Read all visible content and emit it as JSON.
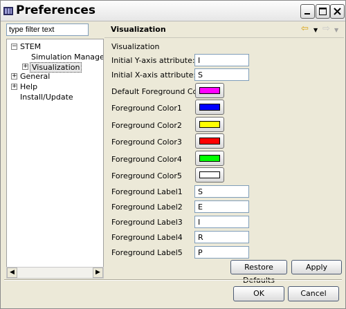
{
  "window": {
    "title": "Preferences"
  },
  "filter": {
    "placeholder": "type filter text"
  },
  "tree": {
    "stem": "STEM",
    "simulation_management": "Simulation Management",
    "visualization": "Visualization",
    "general": "General",
    "help": "Help",
    "install_update": "Install/Update"
  },
  "page": {
    "title": "Visualization",
    "section": "Visualization",
    "initial_y_label": "Initial Y-axis attribute:",
    "initial_y_value": "I",
    "initial_x_label": "Initial X-axis attribute:",
    "initial_x_value": "S",
    "default_fg_label": "Default Foreground Color",
    "fg_color1_label": "Foreground Color1",
    "fg_color2_label": "Foreground Color2",
    "fg_color3_label": "Foreground Color3",
    "fg_color4_label": "Foreground Color4",
    "fg_color5_label": "Foreground Color5",
    "fg_label1_label": "Foreground Label1",
    "fg_label1_value": "S",
    "fg_label2_label": "Foreground Label2",
    "fg_label2_value": "E",
    "fg_label3_label": "Foreground Label3",
    "fg_label3_value": "I",
    "fg_label4_label": "Foreground Label4",
    "fg_label4_value": "R",
    "fg_label5_label": "Foreground Label5",
    "fg_label5_value": "P",
    "restore_defaults": "Restore Defaults",
    "apply": "Apply"
  },
  "colors": {
    "default_fg": "#ff00ff",
    "fg1": "#0000ff",
    "fg2": "#ffff00",
    "fg3": "#ff0000",
    "fg4": "#00ff00",
    "fg5": "#ffffff"
  },
  "dialog": {
    "ok": "OK",
    "cancel": "Cancel"
  }
}
